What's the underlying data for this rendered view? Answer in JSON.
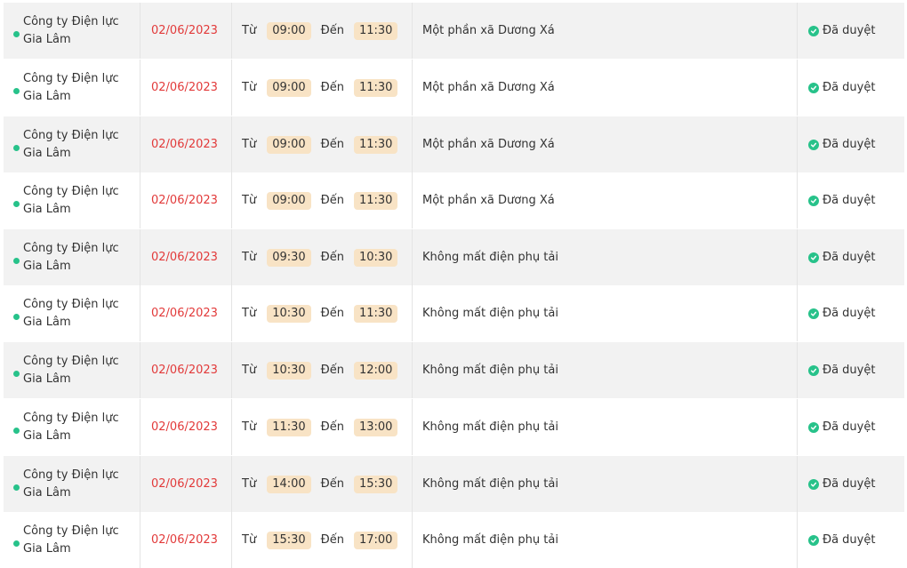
{
  "labels": {
    "from": "Từ",
    "to": "Đến"
  },
  "colors": {
    "accent_green": "#27c28a",
    "date_red": "#e23a3a",
    "badge_bg": "#f8e3c5"
  },
  "rows": [
    {
      "org": "Công ty Điện lực Gia Lâm",
      "date": "02/06/2023",
      "start": "09:00",
      "end": "11:30",
      "area": "Một phần xã Dương Xá",
      "status": "Đã duyệt"
    },
    {
      "org": "Công ty Điện lực Gia Lâm",
      "date": "02/06/2023",
      "start": "09:00",
      "end": "11:30",
      "area": "Một phần xã Dương Xá",
      "status": "Đã duyệt"
    },
    {
      "org": "Công ty Điện lực Gia Lâm",
      "date": "02/06/2023",
      "start": "09:00",
      "end": "11:30",
      "area": "Một phần xã Dương Xá",
      "status": "Đã duyệt"
    },
    {
      "org": "Công ty Điện lực Gia Lâm",
      "date": "02/06/2023",
      "start": "09:00",
      "end": "11:30",
      "area": "Một phần xã Dương Xá",
      "status": "Đã duyệt"
    },
    {
      "org": "Công ty Điện lực Gia Lâm",
      "date": "02/06/2023",
      "start": "09:30",
      "end": "10:30",
      "area": "Không mất điện phụ tải",
      "status": "Đã duyệt"
    },
    {
      "org": "Công ty Điện lực Gia Lâm",
      "date": "02/06/2023",
      "start": "10:30",
      "end": "11:30",
      "area": "Không mất điện phụ tải",
      "status": "Đã duyệt"
    },
    {
      "org": "Công ty Điện lực Gia Lâm",
      "date": "02/06/2023",
      "start": "10:30",
      "end": "12:00",
      "area": "Không mất điện phụ tải",
      "status": "Đã duyệt"
    },
    {
      "org": "Công ty Điện lực Gia Lâm",
      "date": "02/06/2023",
      "start": "11:30",
      "end": "13:00",
      "area": "Không mất điện phụ tải",
      "status": "Đã duyệt"
    },
    {
      "org": "Công ty Điện lực Gia Lâm",
      "date": "02/06/2023",
      "start": "14:00",
      "end": "15:30",
      "area": "Không mất điện phụ tải",
      "status": "Đã duyệt"
    },
    {
      "org": "Công ty Điện lực Gia Lâm",
      "date": "02/06/2023",
      "start": "15:30",
      "end": "17:00",
      "area": "Không mất điện phụ tải",
      "status": "Đã duyệt"
    }
  ]
}
